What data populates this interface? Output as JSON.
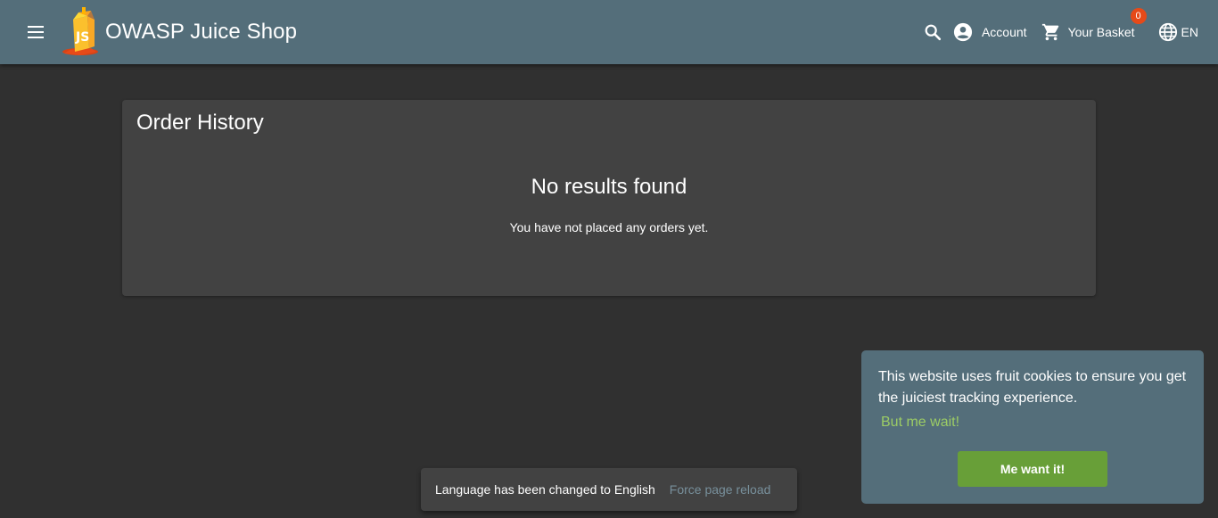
{
  "header": {
    "app_title": "OWASP Juice Shop",
    "menu_icon": "menu-icon",
    "logo_icon": "juice-shop-logo",
    "search_icon": "search-icon",
    "account_label": "Account",
    "account_icon": "account-circle-icon",
    "basket_label": "Your Basket",
    "basket_icon": "shopping-cart-icon",
    "basket_count": "0",
    "language_label": "EN",
    "language_icon": "globe-icon"
  },
  "order_history": {
    "title": "Order History",
    "empty_heading": "No results found",
    "empty_message": "You have not placed any orders yet."
  },
  "cookie_banner": {
    "message": "This website uses fruit cookies to ensure you get the juiciest tracking experience.",
    "link_label": "But me wait!",
    "accept_label": "Me want it!"
  },
  "snackbar": {
    "message": "Language has been changed to English",
    "action_label": "Force page reload"
  },
  "colors": {
    "toolbar": "#546e7a",
    "background": "#303030",
    "card": "#424242",
    "badge": "#e64a19",
    "accept_button": "#689f38",
    "cookie_link": "#9ccc65"
  }
}
